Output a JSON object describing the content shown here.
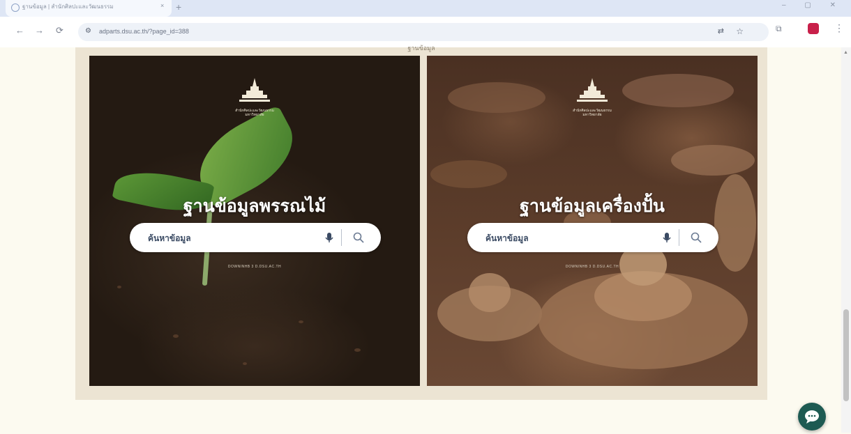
{
  "browser": {
    "tab_title": "ฐานข้อมูล | สำนักศิลปะและวัฒนธรรม",
    "url": "adparts.dsu.ac.th/?page_id=388",
    "tab_close": "×",
    "new_tab": "+",
    "window_controls": "– ▢ ✕"
  },
  "page": {
    "top_text": "ฐานข้อมูล"
  },
  "cards": [
    {
      "title": "ฐานข้อมูลพรรณไม้",
      "search_placeholder": "ค้นหาข้อมูล",
      "powered": "DOWNINHB 3 D.DSU.AC.TH",
      "emblem_text": "สำนักศิลปะและวัฒนธรรม มหาวิทยาลัย"
    },
    {
      "title": "ฐานข้อมูลเครื่องปั้น",
      "search_placeholder": "ค้นหาข้อมูล",
      "powered": "DOWNINHB 3 D.DSU.AC.TH",
      "emblem_text": "สำนักศิลปะและวัฒนธรรม มหาวิทยาลัย"
    }
  ],
  "icons": {
    "back": "←",
    "forward": "→",
    "reload": "⟳",
    "site_info": "⚙",
    "translate": "⇄",
    "star": "☆",
    "extensions": "⧉",
    "menu": "⋮",
    "scroll_up": "▲"
  },
  "colors": {
    "page_bg": "#fcfaf0",
    "panel_frame": "#ece4d3",
    "chat_button": "#1d5a52",
    "search_text": "#3a4a63",
    "profile": "#c8204a"
  }
}
